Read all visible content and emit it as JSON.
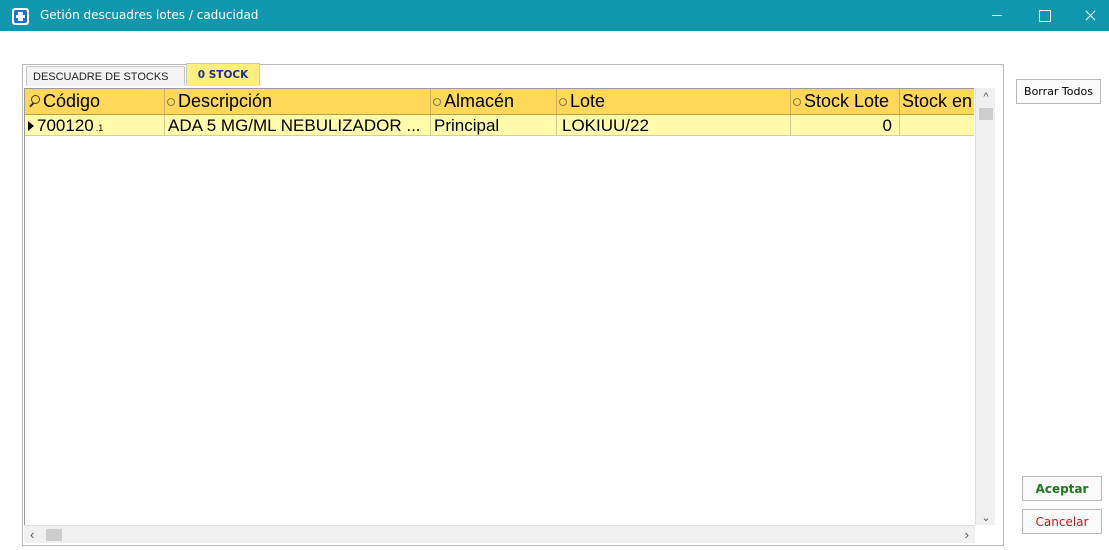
{
  "window": {
    "title": "Getión descuadres lotes / caducidad"
  },
  "tabs": [
    {
      "label": "DESCUADRE DE STOCKS",
      "active": false
    },
    {
      "label": "0 STOCK",
      "active": true
    }
  ],
  "grid": {
    "columns": [
      "Código",
      "Descripción",
      "Almacén",
      "Lote",
      "Stock Lote",
      "Stock en"
    ],
    "rows": [
      {
        "codigo": "700120",
        "codigo_suffix": ".1",
        "descripcion": "ADA 5 MG/ML NEBULIZADOR ...",
        "almacen": "Principal",
        "lote": "LOKIUU/22",
        "stock_lote": "0",
        "stock_en": ""
      }
    ]
  },
  "buttons": {
    "borrar_todos": "Borrar Todos",
    "aceptar": "Aceptar",
    "cancelar": "Cancelar"
  },
  "colors": {
    "titlebar": "#1097b0",
    "header": "#ffd85a",
    "row": "#fffbaa",
    "active_tab": "#ffef7f",
    "aceptar_text": "#1b7a1b",
    "cancelar_text": "#b21c1c"
  }
}
